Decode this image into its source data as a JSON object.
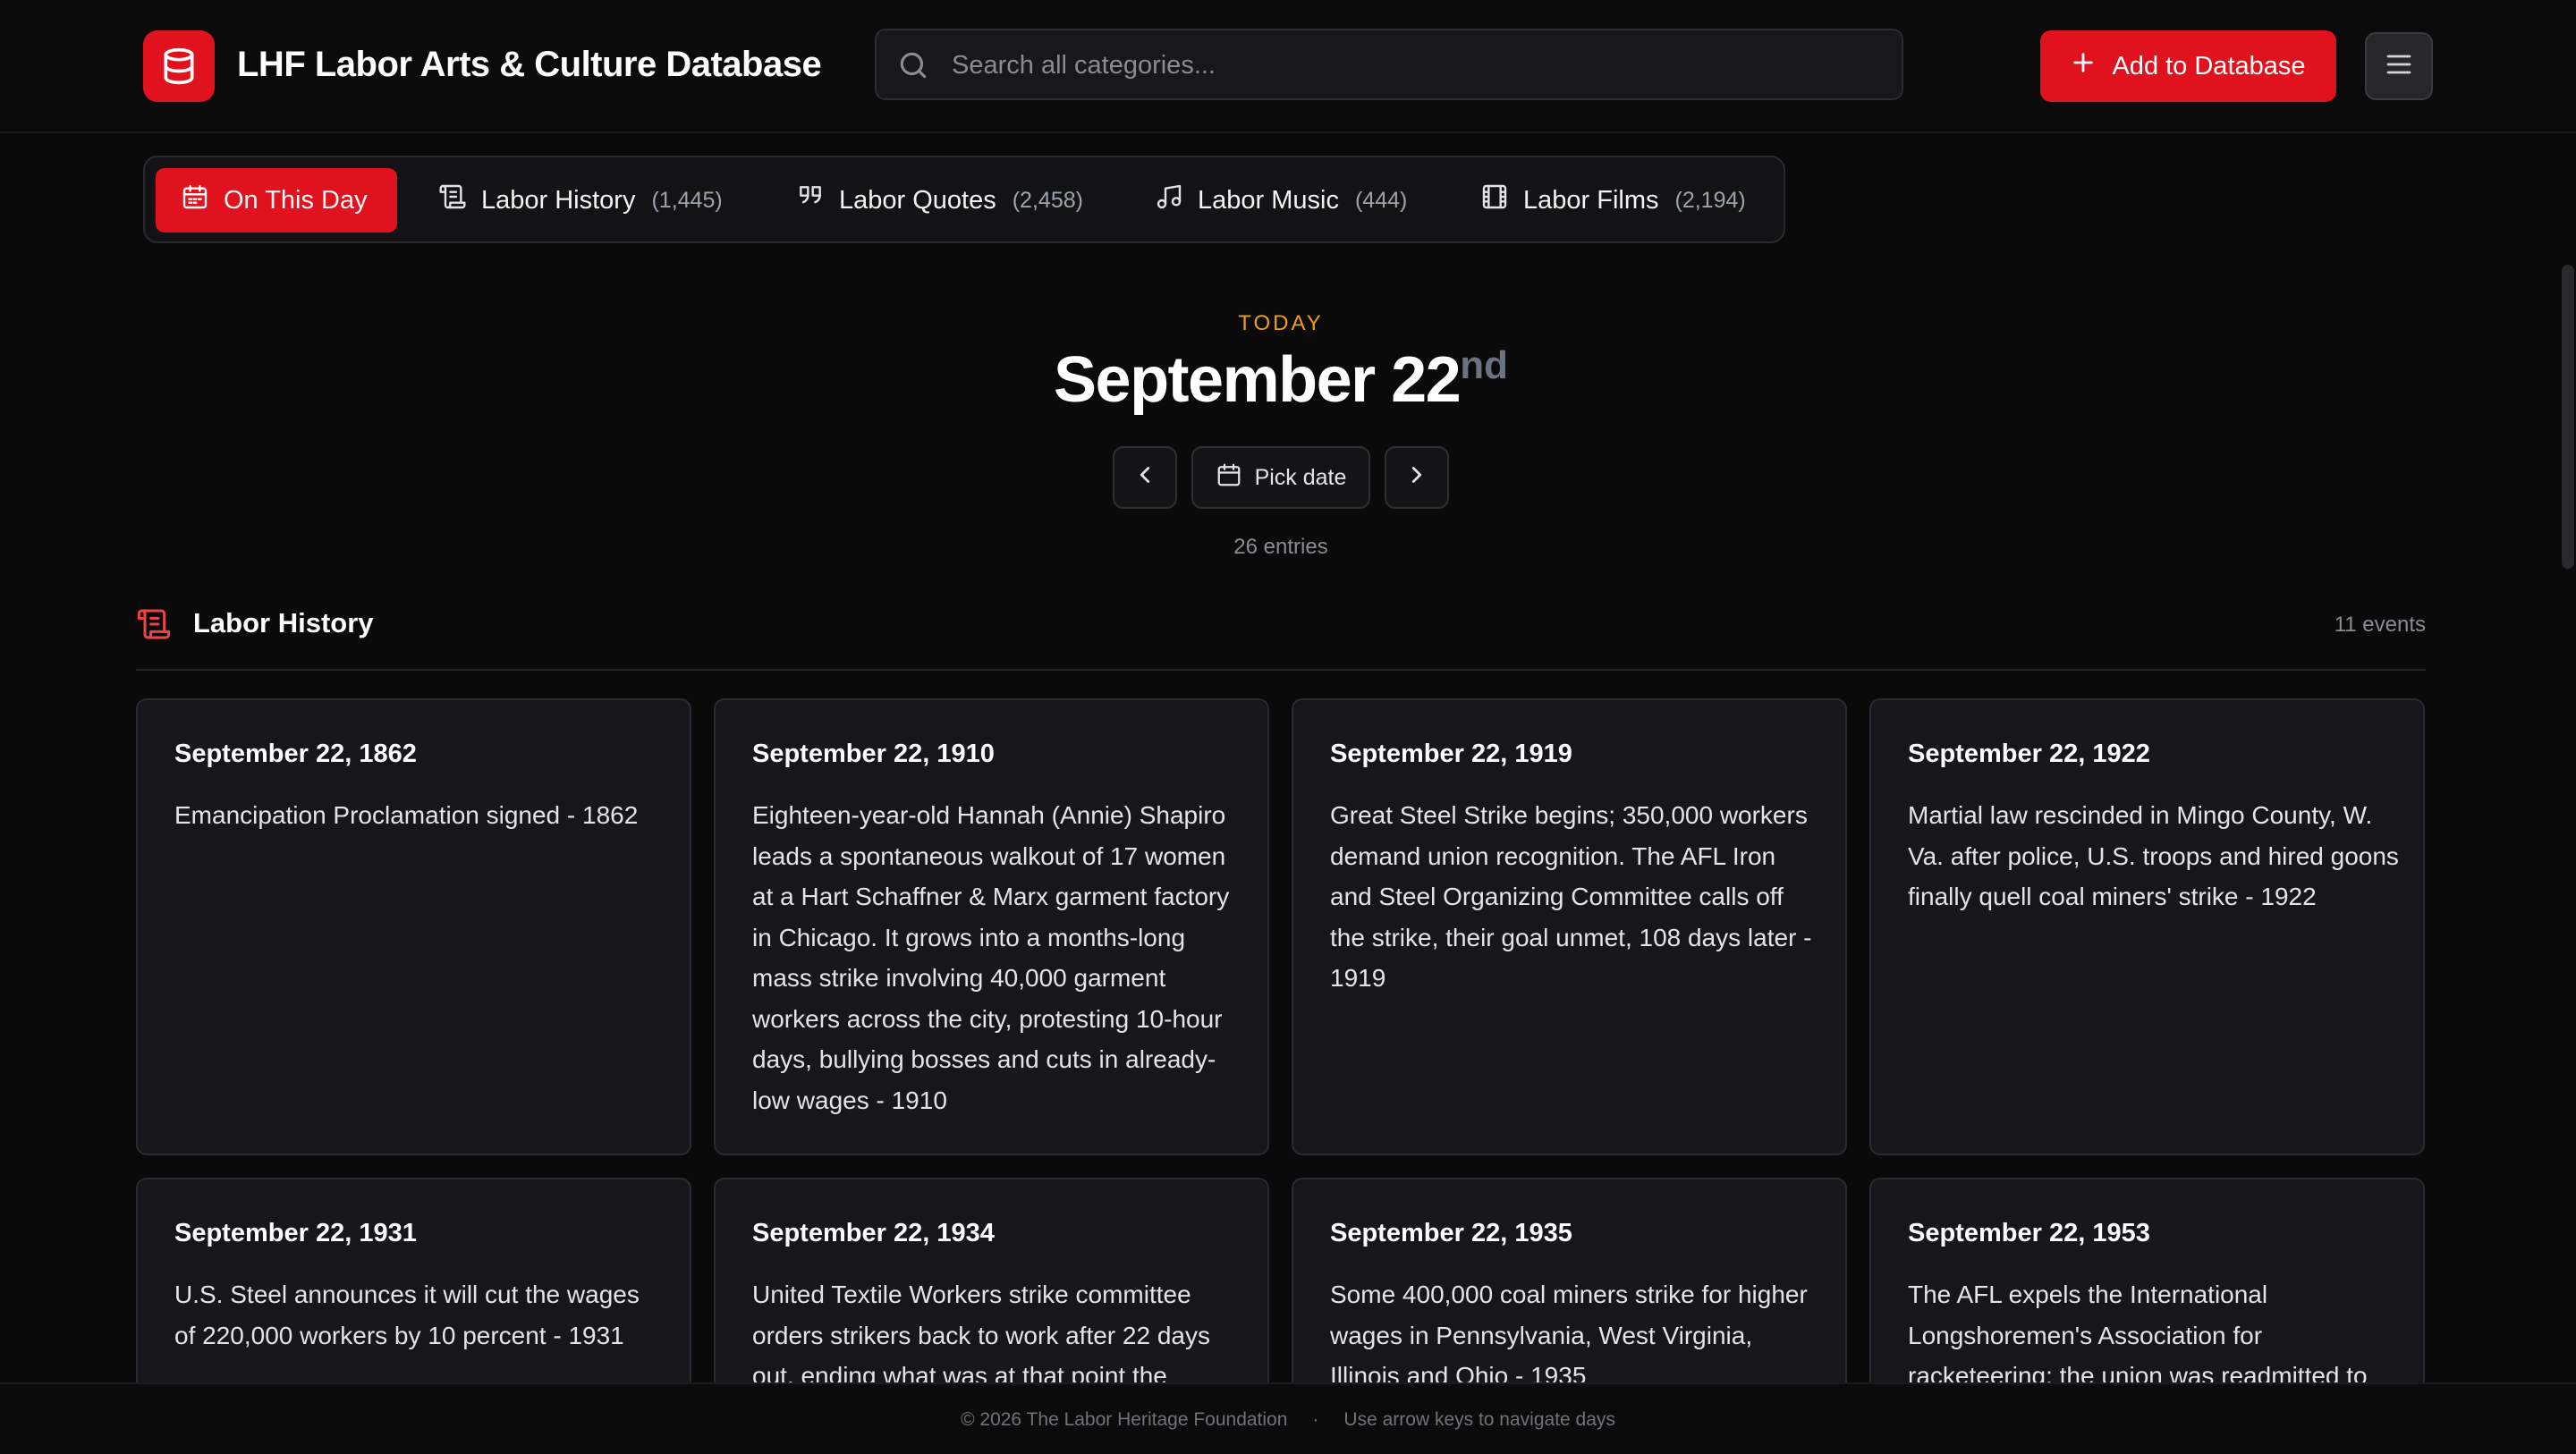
{
  "header": {
    "app_title": "LHF Labor Arts & Culture Database",
    "search_placeholder": "Search all categories...",
    "add_button_label": "Add to Database",
    "brand_color": "#e0121d"
  },
  "tabs": [
    {
      "label": "On This Day",
      "count": "",
      "icon": "calendar-icon",
      "active": true
    },
    {
      "label": "Labor History",
      "count": "(1,445)",
      "icon": "scroll-icon",
      "active": false
    },
    {
      "label": "Labor Quotes",
      "count": "(2,458)",
      "icon": "quote-icon",
      "active": false
    },
    {
      "label": "Labor Music",
      "count": "(444)",
      "icon": "music-note-icon",
      "active": false
    },
    {
      "label": "Labor Films",
      "count": "(2,194)",
      "icon": "film-icon",
      "active": false
    }
  ],
  "day": {
    "today_label": "TODAY",
    "month_day": "September 22",
    "suffix": "nd",
    "pick_date_label": "Pick date",
    "entries": "26 entries"
  },
  "section": {
    "title": "Labor History",
    "count": "11 events"
  },
  "cards": [
    {
      "date": "September 22, 1862",
      "text": "Emancipation Proclamation signed - 1862"
    },
    {
      "date": "September 22, 1910",
      "text": "Eighteen-year-old Hannah (Annie) Shapiro leads a spontaneous walkout of 17 women at a Hart Schaffner & Marx garment factory in Chicago. It grows into a months-long mass strike involving 40,000 garment workers across the city, protesting 10-hour days, bullying bosses and cuts in already-low wages - 1910"
    },
    {
      "date": "September 22, 1919",
      "text": "Great Steel Strike begins; 350,000 workers demand union recognition. The AFL Iron and Steel Organizing Committee calls off the strike, their goal unmet, 108 days later - 1919"
    },
    {
      "date": "September 22, 1922",
      "text": "Martial law rescinded in Mingo County, W. Va. after police, U.S. troops and hired goons finally quell coal miners' strike - 1922"
    },
    {
      "date": "September 22, 1931",
      "text": "U.S. Steel announces it will cut the wages of 220,000 workers by 10 percent - 1931"
    },
    {
      "date": "September 22, 1934",
      "text": "United Textile Workers strike committee orders strikers back to work after 22 days out, ending what was at that point the"
    },
    {
      "date": "September 22, 1935",
      "text": "Some 400,000 coal miners strike for higher wages in Pennsylvania, West Virginia, Illinois and Ohio - 1935"
    },
    {
      "date": "September 22, 1953",
      "text": "The AFL expels the International Longshoremen's Association for racketeering; the union was readmitted to"
    }
  ],
  "footer": {
    "copyright": "© 2026 The Labor Heritage Foundation",
    "separator": "·",
    "hint": "Use arrow keys to navigate days"
  }
}
